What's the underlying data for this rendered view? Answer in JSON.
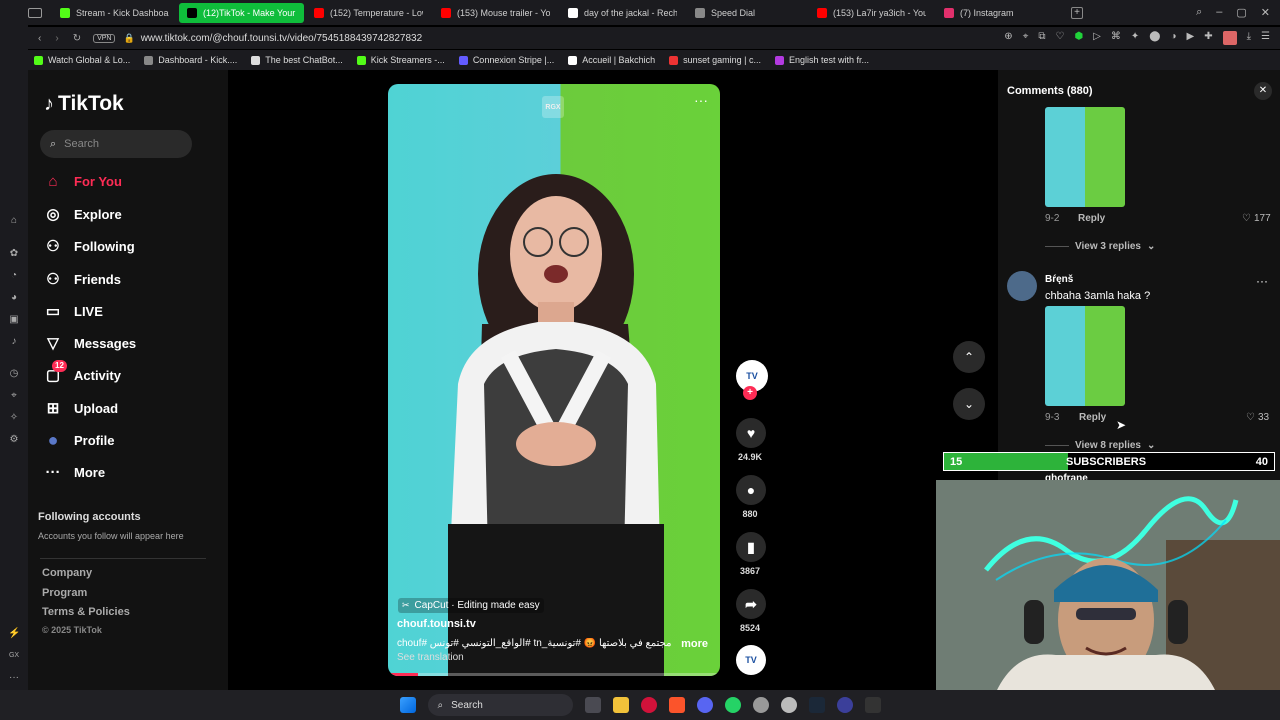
{
  "tabs": [
    {
      "label": "Stream - Kick Dashboard",
      "color": "#53fc18"
    },
    {
      "label": "(12)TikTok - Make Your D",
      "color": "#000000",
      "active": true
    },
    {
      "label": "(152) Temperature - Low",
      "color": "#ff0000"
    },
    {
      "label": "(153) Mouse trailer - YouT",
      "color": "#ff0000"
    },
    {
      "label": "day of the jackal - Reche",
      "color": "#ffffff"
    },
    {
      "label": "Speed Dial",
      "color": "#888888"
    },
    {
      "label": "(153) La7ir ya3ich - YouTu",
      "color": "#ff0000"
    },
    {
      "label": "(7) Instagram",
      "color": "#e1306c"
    }
  ],
  "address": {
    "vpn": "VPN",
    "url": "www.tiktok.com/@chouf.tounsi.tv/video/7545188439742827832"
  },
  "bookmarks": [
    "Watch Global & Lo...",
    "Dashboard - Kick....",
    "The best ChatBot...",
    "Kick Streamers -...",
    "Connexion Stripe |...",
    "Accueil | Bakchich",
    "sunset gaming | c...",
    "English test with fr..."
  ],
  "tiktok": {
    "logo": "TikTok",
    "search_placeholder": "Search",
    "nav": [
      {
        "label": "For You",
        "icon": "home-icon",
        "glyph": "⌂",
        "active": true
      },
      {
        "label": "Explore",
        "icon": "compass-icon",
        "glyph": "◎"
      },
      {
        "label": "Following",
        "icon": "person-plus-icon",
        "glyph": "⚇"
      },
      {
        "label": "Friends",
        "icon": "friends-icon",
        "glyph": "⚇"
      },
      {
        "label": "LIVE",
        "icon": "live-icon",
        "glyph": "▭"
      },
      {
        "label": "Messages",
        "icon": "messages-icon",
        "glyph": "▽"
      },
      {
        "label": "Activity",
        "icon": "activity-icon",
        "glyph": "▢",
        "badge": "12"
      },
      {
        "label": "Upload",
        "icon": "upload-icon",
        "glyph": "⊞"
      },
      {
        "label": "Profile",
        "icon": "avatar-icon",
        "glyph": "●"
      },
      {
        "label": "More",
        "icon": "more-icon",
        "glyph": "···"
      }
    ],
    "following_title": "Following accounts",
    "following_sub": "Accounts you follow will appear here",
    "footer": [
      "Company",
      "Program",
      "Terms & Policies",
      "© 2025 TikTok"
    ]
  },
  "video": {
    "watermark": "RGX",
    "capcut": "CapCut · Editing made easy",
    "author": "chouf.tounsi.tv",
    "caption": "مجتمع في بلاصتها 😡 #تونسية_tn #الواقع_التونسي #تونس #chouf",
    "more": "more",
    "see_translation": "See translation",
    "actions": {
      "likes": "24.9K",
      "comments": "880",
      "saves": "3867",
      "shares": "8524"
    },
    "avatar_text": "TV"
  },
  "comments": {
    "title": "Comments (880)",
    "items": [
      {
        "date": "9-2",
        "reply": "Reply",
        "likes": "177",
        "view_replies": "View 3 replies"
      },
      {
        "user": "Bŕęnš",
        "text": "chbaha 3amla haka ?",
        "date": "9-3",
        "reply": "Reply",
        "likes": "33",
        "view_replies": "View 8 replies"
      }
    ],
    "next_user": "ghofrane"
  },
  "overlay": {
    "left_count": "15",
    "label": "SUBSCRIBERS",
    "right_count": "40",
    "progress": 0.375
  },
  "taskbar": {
    "search": "Search"
  }
}
